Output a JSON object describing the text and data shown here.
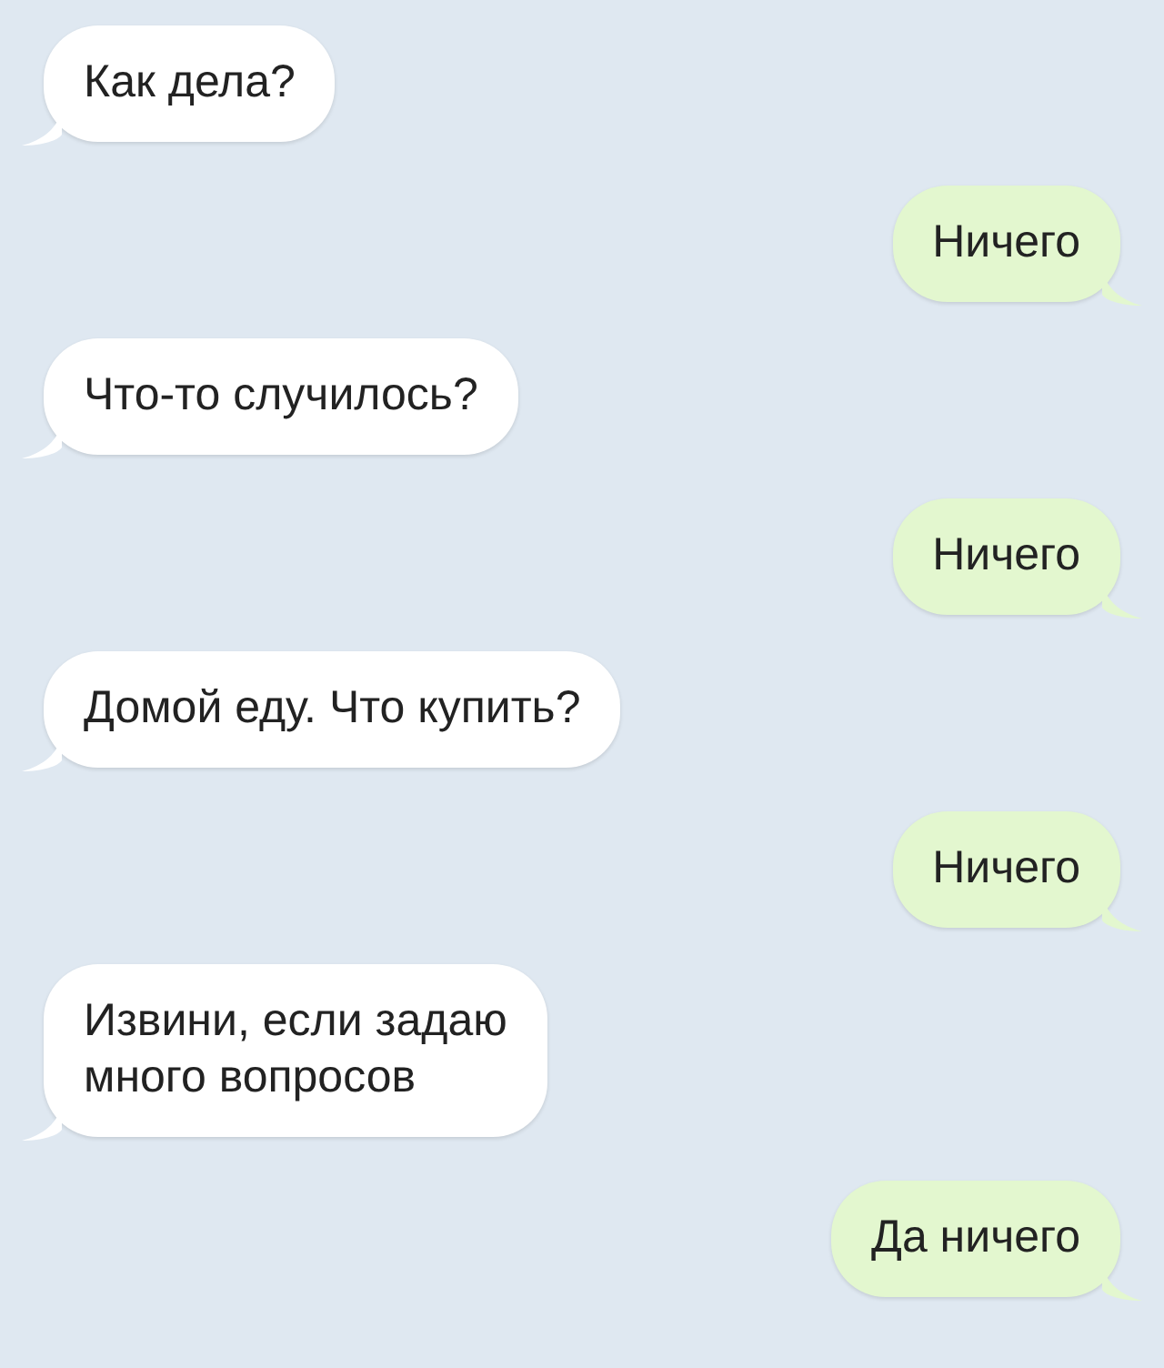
{
  "messages": [
    {
      "kind": "incoming",
      "text": "Как дела?"
    },
    {
      "kind": "outgoing",
      "text": "Ничего"
    },
    {
      "kind": "incoming",
      "text": "Что-то случилось?"
    },
    {
      "kind": "outgoing",
      "text": "Ничего"
    },
    {
      "kind": "incoming",
      "text": "Домой еду. Что купить?"
    },
    {
      "kind": "outgoing",
      "text": "Ничего"
    },
    {
      "kind": "incoming",
      "text": "Извини, если задаю\nмного вопросов"
    },
    {
      "kind": "outgoing",
      "text": "Да ничего"
    }
  ]
}
